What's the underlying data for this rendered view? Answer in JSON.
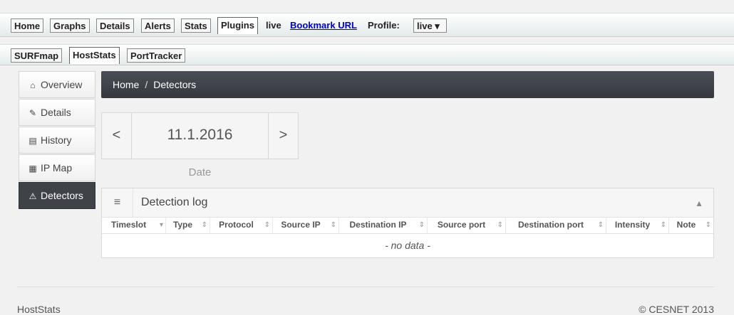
{
  "topnav": {
    "tabs": [
      "Home",
      "Graphs",
      "Details",
      "Alerts",
      "Stats",
      "Plugins"
    ],
    "live_label": "live",
    "bookmark": "Bookmark URL",
    "profile_label": "Profile:",
    "profile_value": "live ▾"
  },
  "plugintabs": [
    "SURFmap",
    "HostStats",
    "PortTracker"
  ],
  "sidebar": {
    "items": [
      {
        "label": "Overview",
        "icon": "home-icon"
      },
      {
        "label": "Details",
        "icon": "edit-icon"
      },
      {
        "label": "History",
        "icon": "list-icon"
      },
      {
        "label": "IP Map",
        "icon": "grid-icon"
      },
      {
        "label": "Detectors",
        "icon": "warning-icon"
      }
    ]
  },
  "breadcrumb": {
    "home": "Home",
    "sep": "/",
    "current": "Detectors"
  },
  "datepicker": {
    "prev": "<",
    "next": ">",
    "value": "11.1.2016",
    "label": "Date"
  },
  "detection_log": {
    "title": "Detection log",
    "columns": [
      "Timeslot",
      "Type",
      "Protocol",
      "Source IP",
      "Destination IP",
      "Source port",
      "Destination port",
      "Intensity",
      "Note"
    ],
    "empty": "- no data -"
  },
  "footer": {
    "left": "HostStats",
    "right": "© CESNET 2013"
  }
}
